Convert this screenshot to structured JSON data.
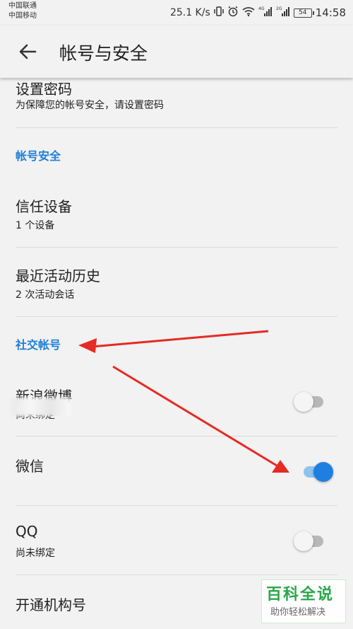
{
  "status_bar": {
    "carrier1": "中国联通",
    "carrier2": "中国移动",
    "speed": "25.1 K/s",
    "battery": "54",
    "time": "14:58",
    "net1": "4G",
    "net2": "2G"
  },
  "app_bar": {
    "title": "帐号与安全"
  },
  "password": {
    "title": "设置密码",
    "subtitle": "为保障您的帐号安全，请设置密码"
  },
  "security_section": {
    "header": "帐号安全"
  },
  "trusted": {
    "title": "信任设备",
    "subtitle": "1 个设备"
  },
  "history": {
    "title": "最近活动历史",
    "subtitle": "2 次活动会话"
  },
  "social_section": {
    "header": "社交帐号"
  },
  "weibo": {
    "title": "新浪微博",
    "subtitle": "尚未绑定",
    "enabled": false
  },
  "wechat": {
    "title": "微信",
    "enabled": true
  },
  "qq": {
    "title": "QQ",
    "subtitle": "尚未绑定",
    "enabled": false
  },
  "org": {
    "title": "开通机构号"
  },
  "watermark": {
    "title": "百科全说",
    "subtitle": "助你轻松解决"
  },
  "colors": {
    "accent": "#1e7fd8",
    "toggle_on": "#1e7fe0",
    "annotation_arrow": "#e52b24"
  }
}
